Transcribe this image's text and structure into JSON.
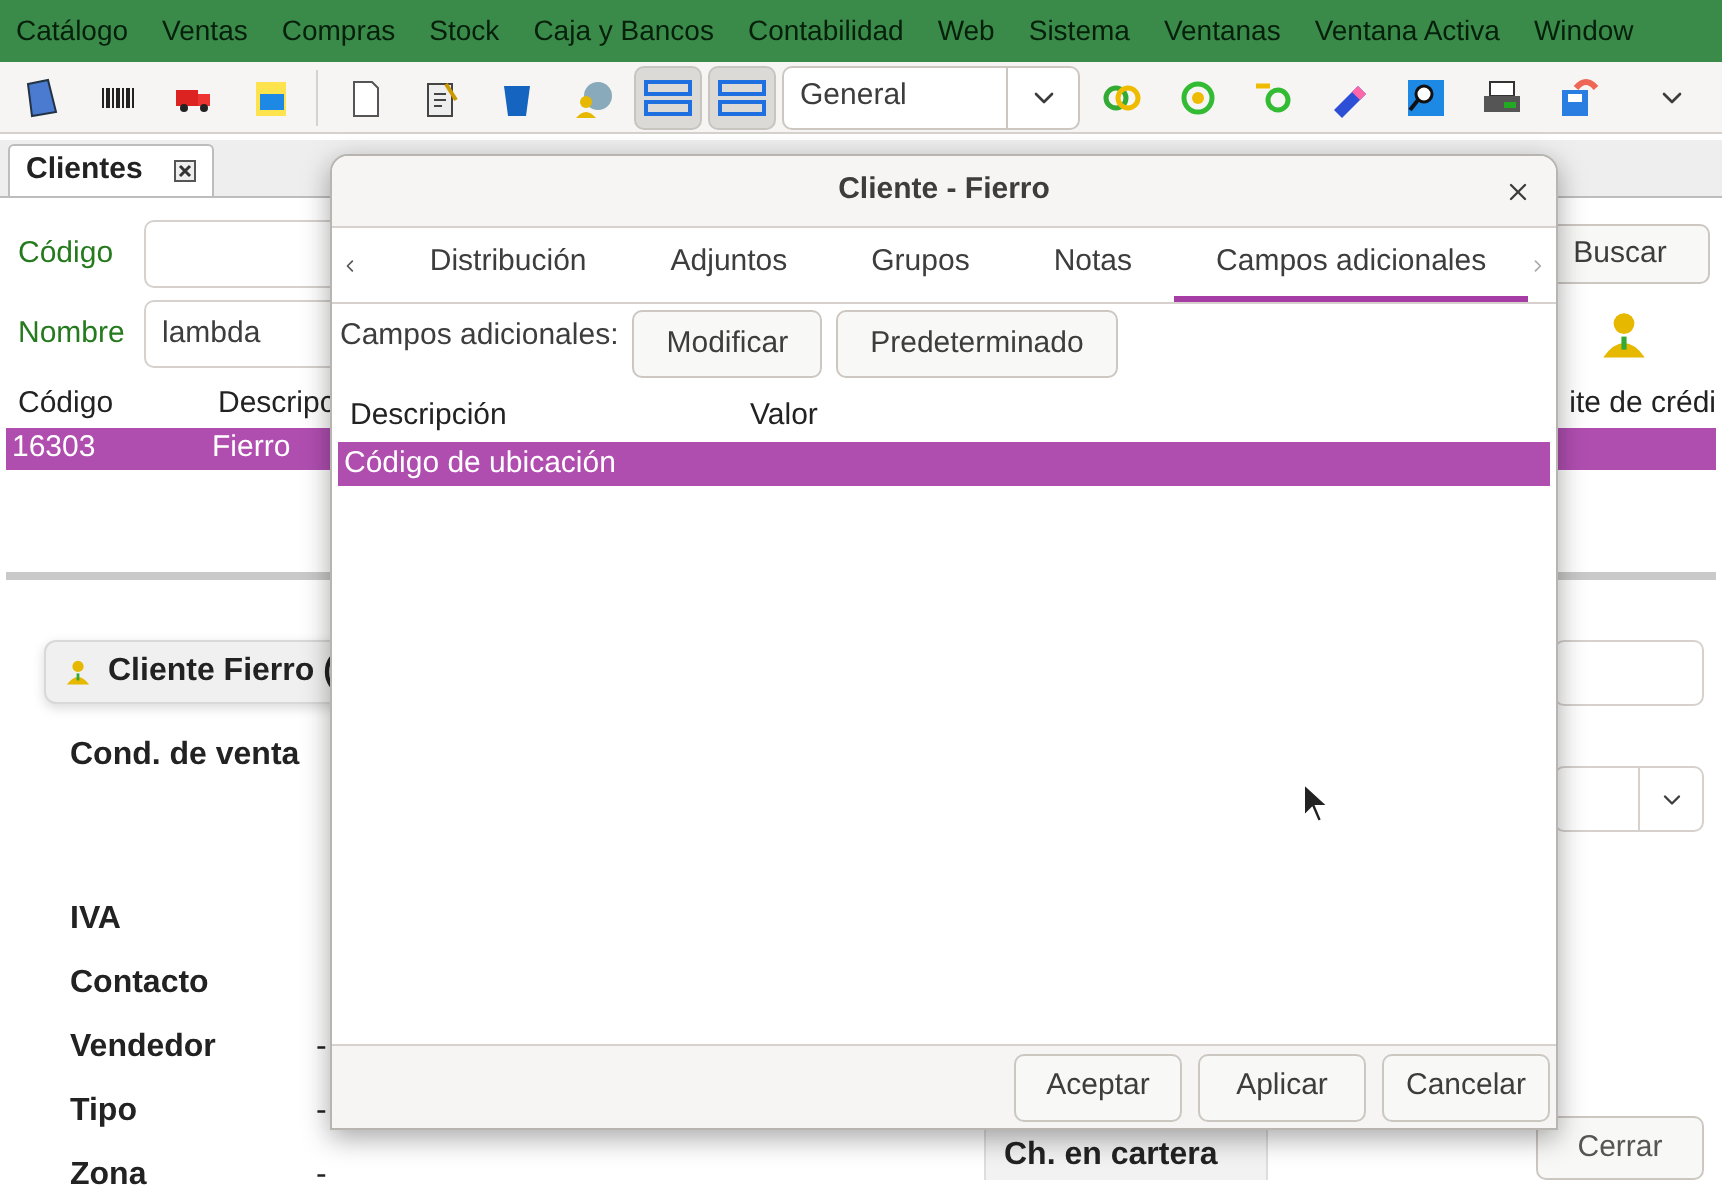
{
  "menu": [
    "Catálogo",
    "Ventas",
    "Compras",
    "Stock",
    "Caja y Bancos",
    "Contabilidad",
    "Web",
    "Sistema",
    "Ventanas",
    "Ventana Activa",
    "Window"
  ],
  "toolbar": {
    "toggles": [
      {
        "selected": true
      },
      {
        "selected": true
      }
    ],
    "combo": {
      "value": "General"
    }
  },
  "main_tab": {
    "label": "Clientes"
  },
  "search": {
    "fields": [
      {
        "label": "Código"
      },
      {
        "label": "Nombre",
        "value": "lambda"
      }
    ],
    "button": "Buscar"
  },
  "clients_table": {
    "columns": [
      "Código",
      "Descripc",
      "ite de crédi"
    ],
    "rows": [
      {
        "cells": [
          "16303",
          "Fierro"
        ],
        "selected": true
      }
    ]
  },
  "detail": {
    "header": "Cliente Fierro (",
    "rows": [
      {
        "label": "Cond. de venta"
      },
      {
        "label": "IVA"
      },
      {
        "label": "Contacto"
      },
      {
        "label": "Vendedor",
        "values": [
          "-"
        ]
      },
      {
        "label": "Tipo",
        "values": [
          "-"
        ]
      },
      {
        "label": "Zona",
        "values": [
          "-"
        ]
      }
    ],
    "tab": "Ch. en cartera",
    "close_button": "Cerrar"
  },
  "dialog": {
    "title": "Cliente - Fierro",
    "tabs": [
      {
        "label": "Distribución",
        "selected": false
      },
      {
        "label": "Adjuntos",
        "selected": false
      },
      {
        "label": "Grupos",
        "selected": false
      },
      {
        "label": "Notas",
        "selected": false
      },
      {
        "label": "Campos adicionales",
        "selected": true
      }
    ],
    "fields_label": "Campos adicionales:",
    "buttons": [
      "Modificar",
      "Predeterminado"
    ],
    "columns": [
      "Descripción",
      "Valor"
    ],
    "rows": [
      {
        "cells": [
          "Código de ubicación"
        ],
        "selected": true
      }
    ],
    "footer_buttons": [
      "Aceptar",
      "Aplicar",
      "Cancelar"
    ]
  }
}
